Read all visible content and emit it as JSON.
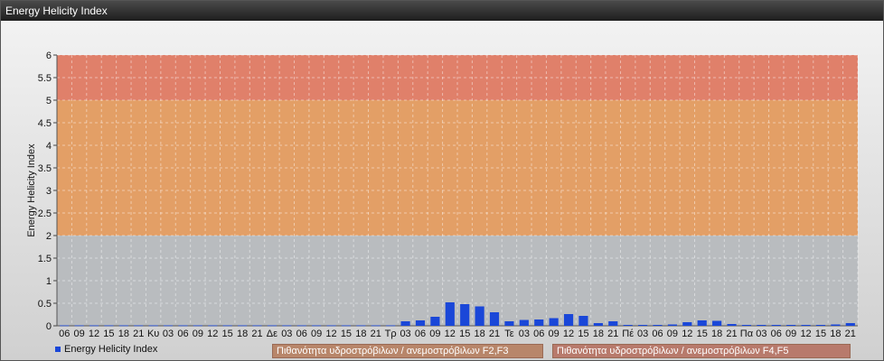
{
  "window": {
    "title": "Energy Helicity Index"
  },
  "chart_data": {
    "type": "bar",
    "title": "Energy Helicity Index",
    "ylabel": "Energy Helicity Index",
    "xlabel": "",
    "ylim": [
      0,
      6
    ],
    "yticks": [
      0,
      0.5,
      1,
      1.5,
      2,
      2.5,
      3,
      3.5,
      4,
      4.5,
      5,
      5.5,
      6
    ],
    "grid": true,
    "legend_position": "bottom-left",
    "bar_color": "#1a47d8",
    "categories": [
      "06",
      "09",
      "12",
      "15",
      "18",
      "21",
      "Κυ",
      "03",
      "06",
      "09",
      "12",
      "15",
      "18",
      "21",
      "Δε",
      "03",
      "06",
      "09",
      "12",
      "15",
      "18",
      "21",
      "Τρ",
      "03",
      "06",
      "09",
      "12",
      "15",
      "18",
      "21",
      "Τε",
      "03",
      "06",
      "09",
      "12",
      "15",
      "18",
      "21",
      "Πέ",
      "03",
      "06",
      "09",
      "12",
      "15",
      "18",
      "21",
      "Πα",
      "03",
      "06",
      "09",
      "12",
      "15",
      "18",
      "21"
    ],
    "series": [
      {
        "name": "Energy Helicity Index",
        "values": [
          0.01,
          0.01,
          0.01,
          0.01,
          0.01,
          0.01,
          0.01,
          0.01,
          0.01,
          0.01,
          0.01,
          0.01,
          0.01,
          0.01,
          0.01,
          0.01,
          0.01,
          0.01,
          0.01,
          0.01,
          0.01,
          0.01,
          0.01,
          0.1,
          0.12,
          0.2,
          0.52,
          0.48,
          0.43,
          0.3,
          0.1,
          0.13,
          0.14,
          0.17,
          0.26,
          0.22,
          0.06,
          0.1,
          0.02,
          0.02,
          0.02,
          0.03,
          0.08,
          0.12,
          0.11,
          0.04,
          0.02,
          0.02,
          0.02,
          0.02,
          0.02,
          0.02,
          0.03,
          0.06
        ]
      }
    ],
    "bands": [
      {
        "from": 2,
        "to": 5,
        "color": "#e39f66",
        "label": "Πιθανότητα υδροστρόβιλων / ανεμοστρόβιλων F2,F3"
      },
      {
        "from": 5,
        "to": 6,
        "color": "#e0806a",
        "label": "Πιθανότητα υδροστρόβιλων / ανεμοστρόβιλων F4,F5"
      }
    ]
  }
}
